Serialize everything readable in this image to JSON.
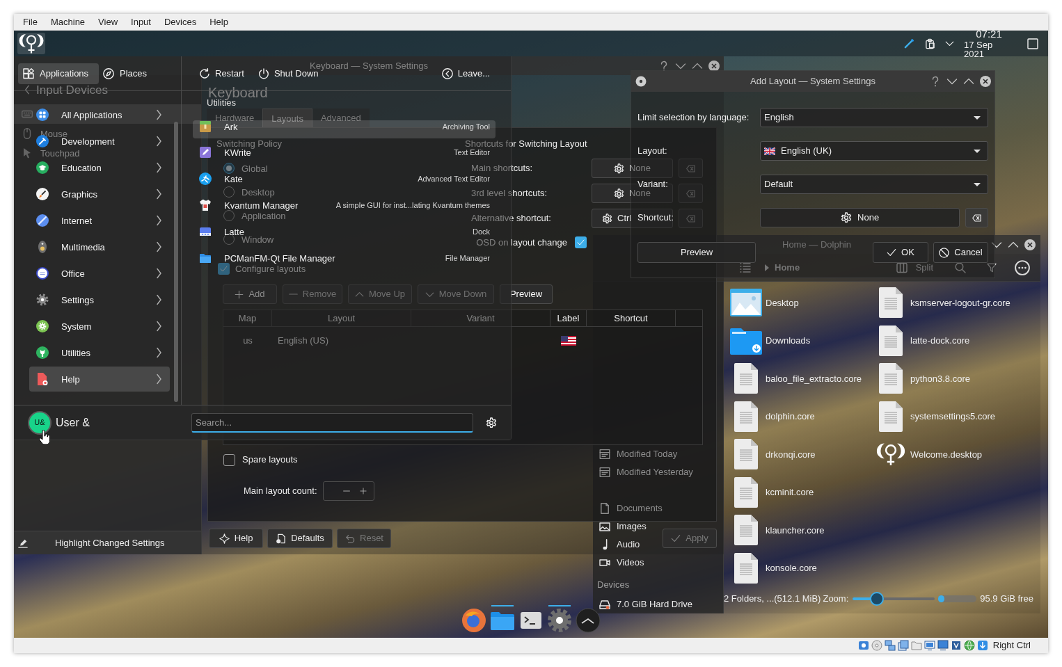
{
  "vm": {
    "menu": [
      {
        "label": "File"
      },
      {
        "label": "Machine"
      },
      {
        "label": "View"
      },
      {
        "label": "Input"
      },
      {
        "label": "Devices"
      },
      {
        "label": "Help"
      }
    ],
    "host_key": "Right Ctrl"
  },
  "panel": {
    "time": "07:21",
    "date": "17 Sep 2021"
  },
  "launcher": {
    "tabs": [
      {
        "label": "Applications",
        "selected": true
      },
      {
        "label": "Places",
        "selected": false
      }
    ],
    "actions": [
      {
        "label": "Restart"
      },
      {
        "label": "Shut Down"
      },
      {
        "label": "Leave..."
      }
    ],
    "categories": [
      {
        "label": "All Applications",
        "selected": false
      },
      {
        "label": "Development",
        "selected": false
      },
      {
        "label": "Education",
        "selected": false
      },
      {
        "label": "Graphics",
        "selected": false
      },
      {
        "label": "Internet",
        "selected": false
      },
      {
        "label": "Multimedia",
        "selected": false
      },
      {
        "label": "Office",
        "selected": false
      },
      {
        "label": "Settings",
        "selected": false
      },
      {
        "label": "System",
        "selected": false
      },
      {
        "label": "Utilities",
        "selected": false
      },
      {
        "label": "Help",
        "selected": true
      }
    ],
    "section_title": "Utilities",
    "apps": [
      {
        "name": "Ark",
        "description": "Archiving Tool",
        "selected": true
      },
      {
        "name": "KWrite",
        "description": "Text Editor",
        "selected": false
      },
      {
        "name": "Kate",
        "description": "Advanced Text Editor",
        "selected": false
      },
      {
        "name": "Kvantum Manager",
        "description": "A simple GUI for inst...lating Kvantum themes",
        "selected": false
      },
      {
        "name": "Latte",
        "description": "Dock",
        "selected": false
      },
      {
        "name": "PCManFM-Qt File Manager",
        "description": "File Manager",
        "selected": false
      }
    ],
    "user": {
      "initials": "U&",
      "name": "User &"
    },
    "search": {
      "placeholder": "Search..."
    }
  },
  "settings": {
    "title": "Keyboard — System Settings",
    "sidebar": {
      "back": "Input Devices",
      "items": [
        {
          "selected": true
        },
        {
          "label": "Mouse",
          "selected": false
        },
        {
          "label": "Touchpad",
          "selected": false
        }
      ],
      "footer": "Highlight Changed Settings"
    },
    "page_title": "Keyboard",
    "tabs": [
      {
        "label": "Hardware",
        "selected": false
      },
      {
        "label": "Layouts",
        "selected": true
      },
      {
        "label": "Advanced",
        "selected": false
      }
    ],
    "switching_policy": {
      "title": "Switching Policy",
      "options": [
        {
          "label": "Global",
          "selected": true
        },
        {
          "label": "Desktop",
          "selected": false
        },
        {
          "label": "Application",
          "selected": false
        },
        {
          "label": "Window",
          "selected": false
        }
      ]
    },
    "shortcuts": {
      "title": "Shortcuts for Switching Layout",
      "rows": [
        {
          "label": "Main shortcuts:",
          "value": "None"
        },
        {
          "label": "3rd level shortcuts:",
          "value": "None"
        },
        {
          "label": "Alternative shortcut:",
          "value": "Ctrl"
        }
      ],
      "osd": {
        "label": "OSD on layout change",
        "checked": true
      }
    },
    "configure_layouts": {
      "label": "Configure layouts",
      "checked": true
    },
    "layout_buttons": [
      {
        "label": "Add",
        "disabled": false
      },
      {
        "label": "Remove",
        "disabled": true
      },
      {
        "label": "Move Up",
        "disabled": true
      },
      {
        "label": "Move Down",
        "disabled": true
      },
      {
        "label": "Preview",
        "disabled": false
      }
    ],
    "table": {
      "columns": [
        "Map",
        "Layout",
        "Variant",
        "Label",
        "Shortcut"
      ],
      "rows": [
        {
          "map": "us",
          "layout": "English (US)"
        }
      ]
    },
    "spare_layouts": {
      "label": "Spare layouts",
      "checked": false
    },
    "main_layout_count": {
      "label": "Main layout count:"
    },
    "footer_buttons": [
      {
        "label": "Help",
        "disabled": false
      },
      {
        "label": "Defaults",
        "disabled": false
      },
      {
        "label": "Reset",
        "disabled": true
      }
    ],
    "apply": {
      "label": "Apply",
      "disabled": true
    }
  },
  "add_layout": {
    "title": "Add Layout — System Settings",
    "rows": [
      {
        "kind": "combo",
        "label": "Limit selection by language:",
        "value": "English",
        "flag": false
      },
      {
        "kind": "combo",
        "label": "Layout:",
        "value": "English (UK)",
        "flag": true
      },
      {
        "kind": "combo",
        "label": "Variant:",
        "value": "Default",
        "flag": false
      },
      {
        "kind": "shortcut",
        "label": "Shortcut:",
        "value": "None"
      }
    ],
    "preview": "Preview",
    "ok": "OK",
    "cancel": "Cancel"
  },
  "dolphin": {
    "title": "Home — Dolphin",
    "breadcrumb": "Home",
    "split": "Split",
    "places": [
      {
        "items": [
          {
            "kind": "date",
            "label": "Modified Today"
          },
          {
            "kind": "date",
            "label": "Modified Yesterday"
          }
        ]
      },
      {
        "items": [
          {
            "kind": "documents",
            "label": "Documents"
          },
          {
            "kind": "images",
            "label": "Images"
          },
          {
            "kind": "audio",
            "label": "Audio"
          },
          {
            "kind": "videos",
            "label": "Videos"
          }
        ]
      }
    ],
    "devices": {
      "title": "Devices",
      "items": [
        {
          "label": "7.0 GiB Hard Drive"
        }
      ]
    },
    "files": [
      {
        "name": "Desktop",
        "kind": "desktop"
      },
      {
        "name": "Downloads",
        "kind": "downloads"
      },
      {
        "name": "baloo_file_extracto.core",
        "kind": "file"
      },
      {
        "name": "dolphin.core",
        "kind": "file"
      },
      {
        "name": "drkonqi.core",
        "kind": "file"
      },
      {
        "name": "kcminit.core",
        "kind": "file"
      },
      {
        "name": "klauncher.core",
        "kind": "file"
      },
      {
        "name": "konsole.core",
        "kind": "file"
      },
      {
        "name": "ksmserver-logout-gr.core",
        "kind": "file"
      },
      {
        "name": "latte-dock.core",
        "kind": "file"
      },
      {
        "name": "python3.8.core",
        "kind": "file"
      },
      {
        "name": "systemsettings5.core",
        "kind": "file"
      },
      {
        "name": "Welcome.desktop",
        "kind": "launcher"
      }
    ],
    "status": "2 Folders, ...(512.1 MiB)",
    "zoom": {
      "label": "Zoom:",
      "level": 0.25
    },
    "free_space": {
      "level": 0.15,
      "text": "95.9 GiB free"
    }
  },
  "dock": {
    "items": [
      {
        "running": false
      },
      {
        "running": true
      },
      {
        "running": false
      },
      {
        "running": true
      },
      {
        "running": false
      }
    ]
  }
}
